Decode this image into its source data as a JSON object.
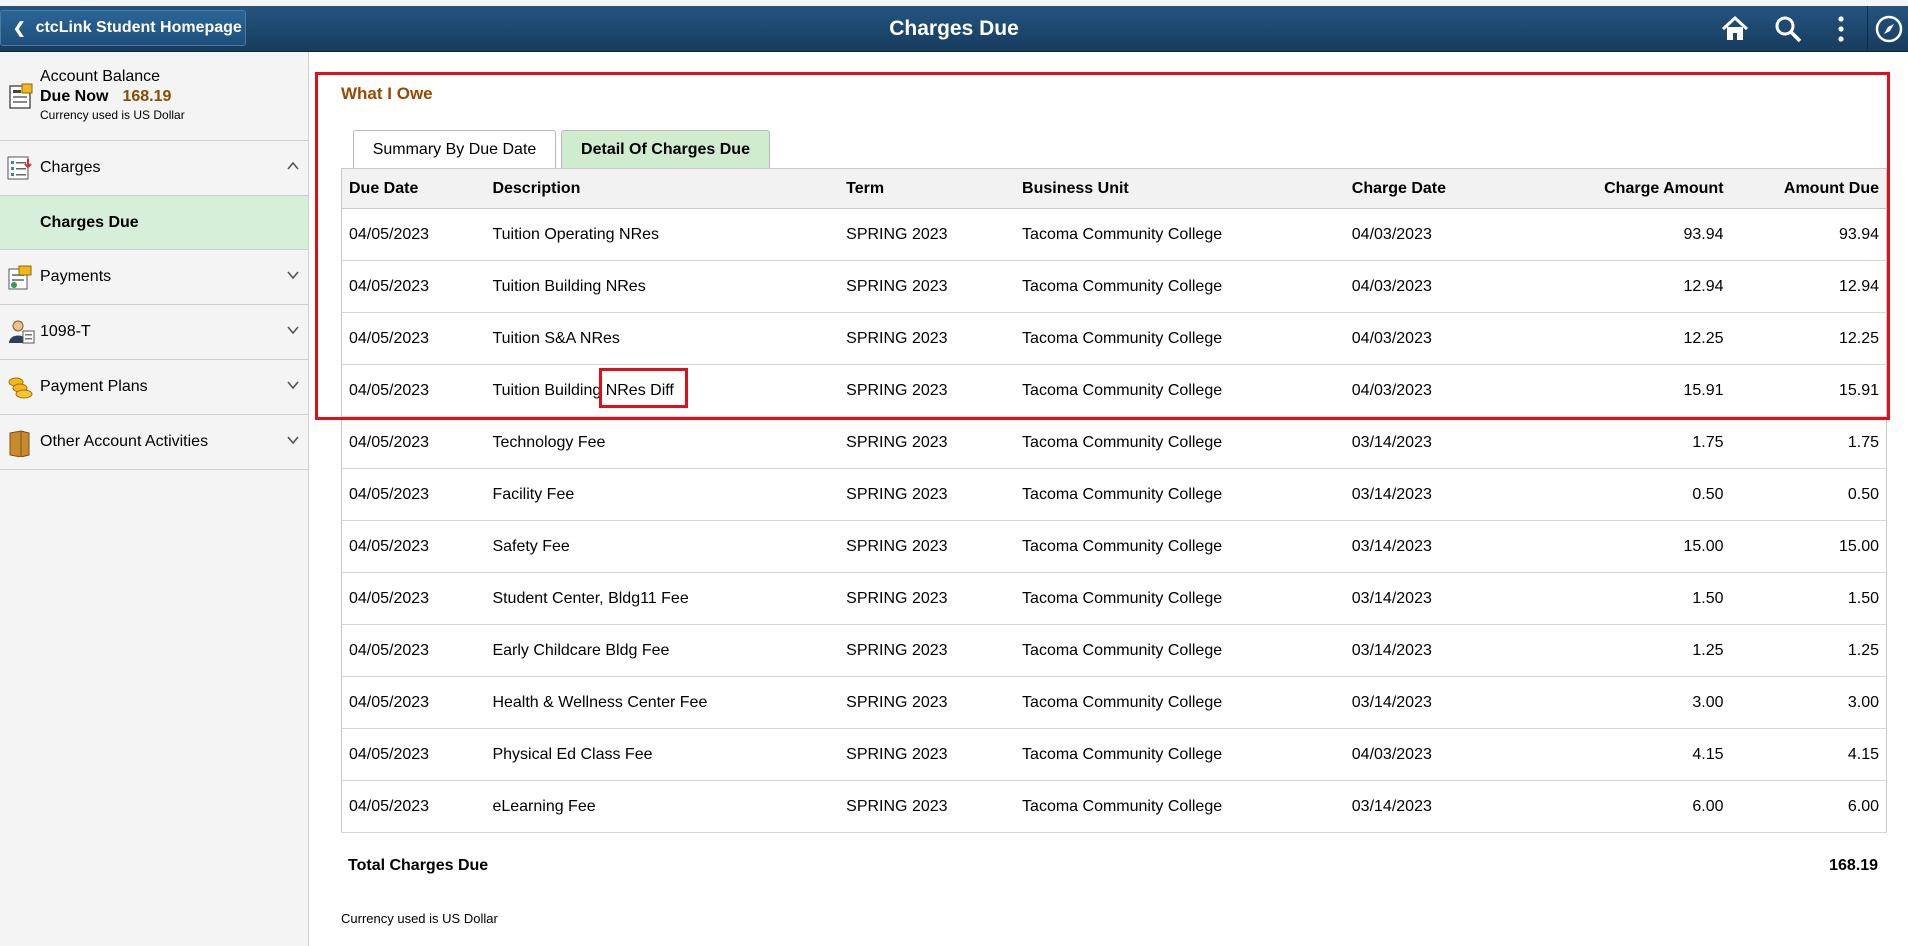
{
  "header": {
    "back_label": "ctcLink Student Homepage",
    "title": "Charges Due",
    "icons": [
      "home-icon",
      "search-icon",
      "more-icon",
      "compass-icon"
    ]
  },
  "sidebar": {
    "account": {
      "title": "Account Balance",
      "due_label": "Due Now",
      "due_amount": "168.19",
      "currency": "Currency used is US Dollar"
    },
    "items": [
      {
        "label": "Charges",
        "icon": "charges-icon",
        "expanded": true
      },
      {
        "label": "Charges Due",
        "sub": true,
        "selected": true
      },
      {
        "label": "Payments",
        "icon": "payments-icon"
      },
      {
        "label": "1098-T",
        "icon": "person-tax-icon"
      },
      {
        "label": "Payment Plans",
        "icon": "coins-icon"
      },
      {
        "label": "Other Account Activities",
        "icon": "folder-icon"
      }
    ]
  },
  "main": {
    "section_title": "What I Owe",
    "tabs": [
      {
        "label": "Summary By Due Date",
        "active": false
      },
      {
        "label": "Detail Of Charges Due",
        "active": true
      }
    ],
    "columns": [
      "Due Date",
      "Description",
      "Term",
      "Business Unit",
      "Charge Date",
      "Charge Amount",
      "Amount Due"
    ],
    "rows": [
      {
        "due": "04/05/2023",
        "desc": "Tuition Operating NRes",
        "term": "SPRING 2023",
        "unit": "Tacoma Community College",
        "cdate": "04/03/2023",
        "camt": "93.94",
        "adue": "93.94"
      },
      {
        "due": "04/05/2023",
        "desc": "Tuition Building NRes",
        "term": "SPRING 2023",
        "unit": "Tacoma Community College",
        "cdate": "04/03/2023",
        "camt": "12.94",
        "adue": "12.94"
      },
      {
        "due": "04/05/2023",
        "desc": "Tuition S&A NRes",
        "term": "SPRING 2023",
        "unit": "Tacoma Community College",
        "cdate": "04/03/2023",
        "camt": "12.25",
        "adue": "12.25"
      },
      {
        "due": "04/05/2023",
        "desc": "Tuition Building NRes Diff",
        "term": "SPRING 2023",
        "unit": "Tacoma Community College",
        "cdate": "04/03/2023",
        "camt": "15.91",
        "adue": "15.91"
      },
      {
        "due": "04/05/2023",
        "desc": "Technology Fee",
        "term": "SPRING 2023",
        "unit": "Tacoma Community College",
        "cdate": "03/14/2023",
        "camt": "1.75",
        "adue": "1.75"
      },
      {
        "due": "04/05/2023",
        "desc": "Facility Fee",
        "term": "SPRING 2023",
        "unit": "Tacoma Community College",
        "cdate": "03/14/2023",
        "camt": "0.50",
        "adue": "0.50"
      },
      {
        "due": "04/05/2023",
        "desc": "Safety Fee",
        "term": "SPRING 2023",
        "unit": "Tacoma Community College",
        "cdate": "03/14/2023",
        "camt": "15.00",
        "adue": "15.00"
      },
      {
        "due": "04/05/2023",
        "desc": "Student Center, Bldg11 Fee",
        "term": "SPRING 2023",
        "unit": "Tacoma Community College",
        "cdate": "03/14/2023",
        "camt": "1.50",
        "adue": "1.50"
      },
      {
        "due": "04/05/2023",
        "desc": "Early Childcare Bldg Fee",
        "term": "SPRING 2023",
        "unit": "Tacoma Community College",
        "cdate": "03/14/2023",
        "camt": "1.25",
        "adue": "1.25"
      },
      {
        "due": "04/05/2023",
        "desc": "Health & Wellness Center Fee",
        "term": "SPRING 2023",
        "unit": "Tacoma Community College",
        "cdate": "03/14/2023",
        "camt": "3.00",
        "adue": "3.00"
      },
      {
        "due": "04/05/2023",
        "desc": "Physical Ed Class Fee",
        "term": "SPRING 2023",
        "unit": "Tacoma Community College",
        "cdate": "04/03/2023",
        "camt": "4.15",
        "adue": "4.15"
      },
      {
        "due": "04/05/2023",
        "desc": "eLearning Fee",
        "term": "SPRING 2023",
        "unit": "Tacoma Community College",
        "cdate": "03/14/2023",
        "camt": "6.00",
        "adue": "6.00"
      }
    ],
    "total_label": "Total Charges Due",
    "total_value": "168.19",
    "currency_note": "Currency used is US Dollar"
  },
  "colors": {
    "header": "#1f4a71",
    "highlight": "#e0101a",
    "accent": "#9a4a00",
    "selected": "#d6efd9"
  }
}
